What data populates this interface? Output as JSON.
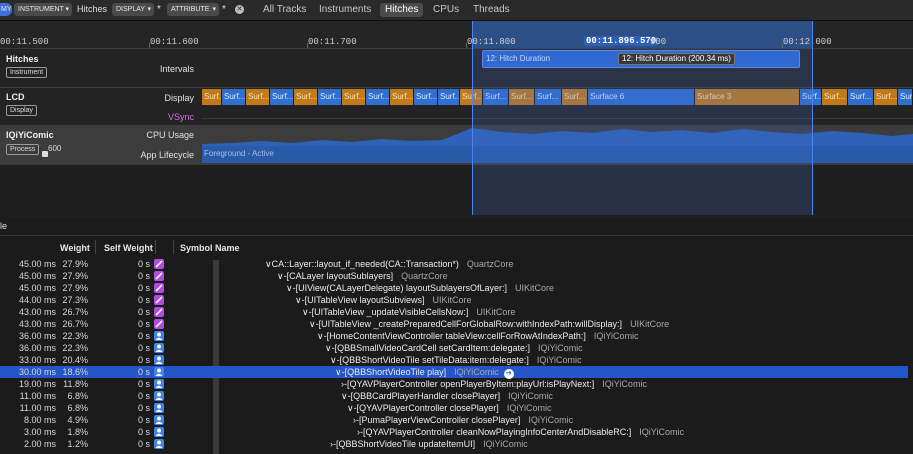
{
  "toolbar": {
    "record_badge": "MY",
    "filter_instrument": "INSTRUMENT",
    "filter_instrument_value": "Hitches",
    "filter_display": "DISPLAY",
    "filter_attribute": "ATTRIBUTE",
    "tabs": [
      {
        "label": "All Tracks",
        "active": false
      },
      {
        "label": "Instruments",
        "active": false
      },
      {
        "label": "Hitches",
        "active": true
      },
      {
        "label": "CPUs",
        "active": false
      },
      {
        "label": "Threads",
        "active": false
      }
    ]
  },
  "ruler": {
    "ticks": [
      "00:11.500",
      "00:11.600",
      "00:11.700",
      "00:11.800",
      "900",
      "00:12.000"
    ],
    "cursor_label": "00:11.896.570"
  },
  "tracks": {
    "hitches": {
      "name": "Hitches",
      "badge": "Instrument",
      "lane": "Intervals",
      "hitch_label": "12: Hitch Duration",
      "hitch_tooltip": "12: Hitch Duration (200.34 ms)"
    },
    "lcd": {
      "name": "LCD",
      "badge": "Display",
      "lane_display": "Display",
      "lane_vsync": "VSync",
      "seg_short": "Surf...",
      "seg_long1": "Surface 6",
      "seg_long2": "Surface 3"
    },
    "app": {
      "name": "IQiYiComic",
      "badge": "Process",
      "pid": "600",
      "lane_cpu": "CPU Usage",
      "lane_lifecycle": "App Lifecycle",
      "lifecycle_state": "Foreground - Active"
    }
  },
  "table": {
    "title_fragment": "le",
    "headers": {
      "weight": "Weight",
      "self_weight": "Self Weight",
      "symbol": "Symbol Name"
    },
    "rows": [
      {
        "ms": "45.00 ms",
        "pct": "27.9%",
        "self": "0 s",
        "icon": "purple",
        "sym": "∨CA::Layer::layout_if_needed(CA::Transaction*)",
        "lib": "QuartzCore"
      },
      {
        "ms": "45.00 ms",
        "pct": "27.9%",
        "self": "0 s",
        "icon": "purple",
        "sym": "∨-[CALayer layoutSublayers]",
        "lib": "QuartzCore"
      },
      {
        "ms": "45.00 ms",
        "pct": "27.9%",
        "self": "0 s",
        "icon": "purple-doc",
        "sym": "∨-[UIView(CALayerDelegate) layoutSublayersOfLayer:]",
        "lib": "UIKitCore"
      },
      {
        "ms": "44.00 ms",
        "pct": "27.3%",
        "self": "0 s",
        "icon": "purple-doc",
        "sym": "∨-[UITableView layoutSubviews]",
        "lib": "UIKitCore"
      },
      {
        "ms": "43.00 ms",
        "pct": "26.7%",
        "self": "0 s",
        "icon": "purple-doc",
        "sym": "∨-[UITableView _updateVisibleCellsNow:]",
        "lib": "UIKitCore"
      },
      {
        "ms": "43.00 ms",
        "pct": "26.7%",
        "self": "0 s",
        "icon": "purple-doc",
        "sym": "∨-[UITableView _createPreparedCellForGlobalRow:withIndexPath:willDisplay:]",
        "lib": "UIKitCore"
      },
      {
        "ms": "36.00 ms",
        "pct": "22.3%",
        "self": "0 s",
        "icon": "blue",
        "sym": "∨-[HomeContentViewController tableView:cellForRowAtIndexPath:]",
        "lib": "IQiYiComic"
      },
      {
        "ms": "36.00 ms",
        "pct": "22.3%",
        "self": "0 s",
        "icon": "blue",
        "sym": "∨-[QBBSmallVideoCardCell setCardItem:delegate:]",
        "lib": "IQiYiComic"
      },
      {
        "ms": "33.00 ms",
        "pct": "20.4%",
        "self": "0 s",
        "icon": "blue",
        "sym": "∨-[QBBShortVideoTile setTileData:item:delegate:]",
        "lib": "IQiYiComic"
      },
      {
        "ms": "30.00 ms",
        "pct": "18.6%",
        "self": "0 s",
        "icon": "blue",
        "sym": "∨-[QBBShortVideoTile play]",
        "lib": "IQiYiComic",
        "selected": true
      },
      {
        "ms": "19.00 ms",
        "pct": "11.8%",
        "self": "0 s",
        "icon": "blue",
        "sym": "›-[QYAVPlayerController openPlayerByItem:playUrl:isPlayNext:]",
        "lib": "IQiYiComic"
      },
      {
        "ms": "11.00 ms",
        "pct": "6.8%",
        "self": "0 s",
        "icon": "blue",
        "sym": "∨-[QBBCardPlayerHandler closePlayer]",
        "lib": "IQiYiComic"
      },
      {
        "ms": "11.00 ms",
        "pct": "6.8%",
        "self": "0 s",
        "icon": "blue",
        "sym": "∨-[QYAVPlayerController closePlayer]",
        "lib": "IQiYiComic"
      },
      {
        "ms": "8.00 ms",
        "pct": "4.9%",
        "self": "0 s",
        "icon": "blue",
        "sym": "›-[PumaPlayerViewController closePlayer]",
        "lib": "IQiYiComic"
      },
      {
        "ms": "3.00 ms",
        "pct": "1.8%",
        "self": "0 s",
        "icon": "blue",
        "sym": "›-[QYAVPlayerController cleanNowPlayingInfoCenterAndDisableRC:]",
        "lib": "IQiYiComic"
      },
      {
        "ms": "2.00 ms",
        "pct": "1.2%",
        "self": "0 s",
        "icon": "blue",
        "sym": "›-[QBBShortVideoTile updateItemUI]",
        "lib": "IQiYiComic"
      }
    ]
  },
  "colors": {
    "selection": "#2456c8",
    "segment_blue": "#2f6fd0",
    "segment_orange": "#c07a1a",
    "purple_icon": "#b04ce0",
    "user_icon": "#3f84e8"
  }
}
